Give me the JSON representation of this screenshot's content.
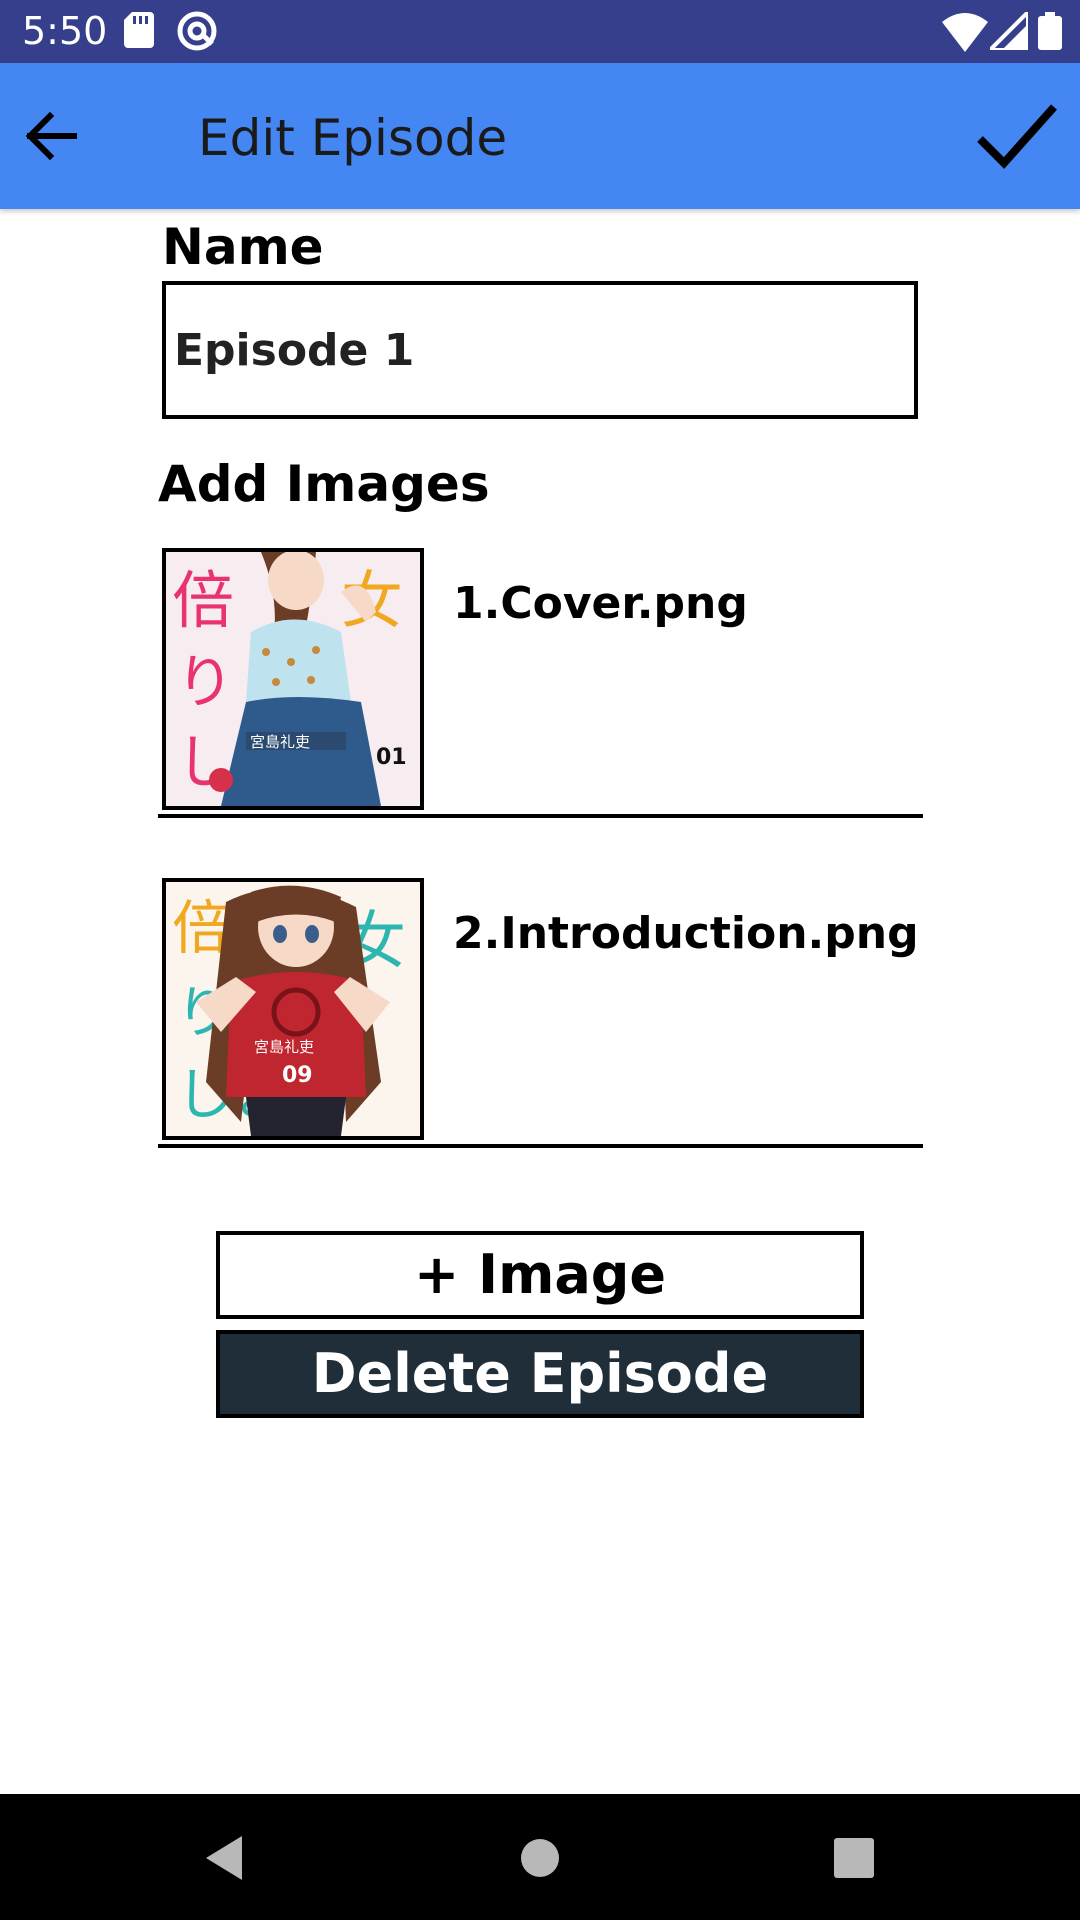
{
  "status_bar": {
    "time": "5:50",
    "icons": [
      "sd-card-icon",
      "at-sign-icon",
      "wifi-icon",
      "cell-signal-icon",
      "battery-icon"
    ]
  },
  "app_bar": {
    "title": "Edit Episode",
    "back_icon": "arrow-back-icon",
    "confirm_icon": "check-icon",
    "background": "#4487f2"
  },
  "form": {
    "name_label": "Name",
    "name_value": "Episode 1",
    "images_label": "Add Images"
  },
  "images": [
    {
      "file_name": "1.Cover.png",
      "cover_number": "01",
      "author": "宮島礼吏"
    },
    {
      "file_name": "2.Introduction.png",
      "cover_number": "09",
      "author": "宮島礼吏"
    }
  ],
  "buttons": {
    "add_image": "+ Image",
    "delete_episode": "Delete Episode"
  },
  "nav_bar": {
    "icons": [
      "nav-back-icon",
      "nav-home-icon",
      "nav-recents-icon"
    ]
  },
  "colors": {
    "status_bar": "#353f8c",
    "delete_button": "#1f2e38"
  }
}
